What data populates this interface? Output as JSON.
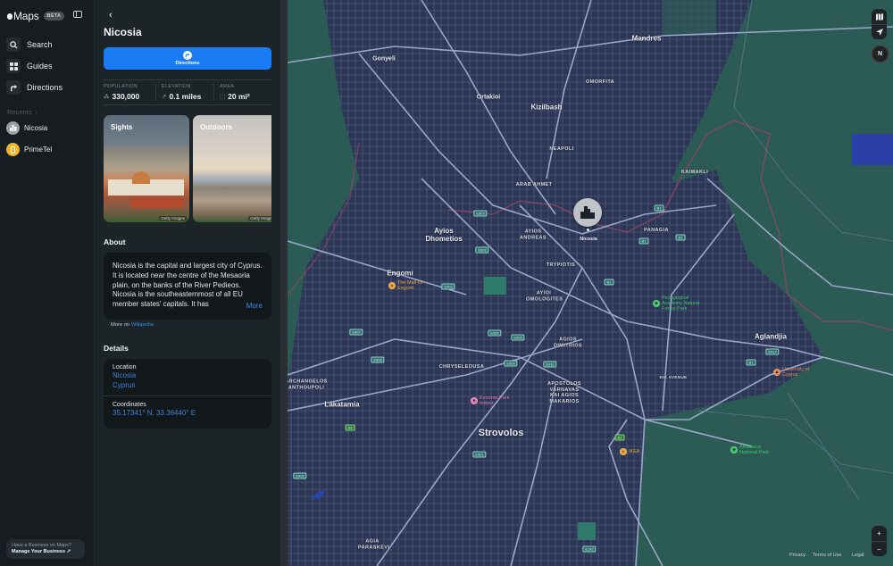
{
  "app": {
    "name": "Maps",
    "badge": "BETA"
  },
  "sidebar": {
    "nav": [
      {
        "label": "Search",
        "icon": "search-icon"
      },
      {
        "label": "Guides",
        "icon": "guides-grid-icon"
      },
      {
        "label": "Directions",
        "icon": "directions-arrow-icon"
      }
    ],
    "recents_label": "Recents",
    "recents": [
      {
        "label": "Nicosia",
        "icon": "city-icon",
        "color": "#9aa0a5"
      },
      {
        "label": "PrimeTel",
        "icon": "phone-store-icon",
        "color": "#f0b429"
      }
    ],
    "business": {
      "line1": "Have a Business on Maps?",
      "line2": "Manage Your Business ↗"
    }
  },
  "place": {
    "title": "Nicosia",
    "directions_label": "Directions",
    "stats": [
      {
        "key": "POPULATION",
        "value": "330,000",
        "icon": "population-icon"
      },
      {
        "key": "ELEVATION",
        "value": "0.1 miles",
        "icon": "elevation-arrow-icon"
      },
      {
        "key": "AREA",
        "value": "20 mi²",
        "icon": "area-square-icon"
      }
    ],
    "guides": [
      {
        "label": "Sights",
        "credit": "Getty Images"
      },
      {
        "label": "Outdoors",
        "credit": "Getty Images"
      }
    ],
    "about_heading": "About",
    "about_text": "Nicosia is the capital and largest city of Cyprus. It is located near the centre of the Mesaoria plain, on the banks of the River Pedieos. Nicosia is the southeasternmost of all EU member states' capitals. It has",
    "about_more": "More",
    "wiki_prefix": "More on",
    "wiki_link": "Wikipedia",
    "details_heading": "Details",
    "details": {
      "location_label": "Location",
      "location_lines": [
        "Nicosia",
        "Cyprus"
      ],
      "coordinates_label": "Coordinates",
      "coordinates": "35.17341° N, 33.36440° E"
    }
  },
  "map": {
    "pin_label": "Nicosia",
    "compass": "N",
    "zoom_in": "+",
    "zoom_out": "−",
    "legal": [
      "Privacy",
      "Terms of Use",
      "Legal"
    ],
    "labels": {
      "mandres": "Mandres",
      "gonyeli": "Gonyeli",
      "ortakioi": "Ortakioi",
      "kizilbash": "Kizilbash",
      "omorfita": "OMORFITA",
      "neapoli": "NEAPOLI",
      "kaimakli": "KAIMAKLI",
      "arab_ahmet": "ARAB AHMET",
      "ayios_dhometios": "Ayios Dhometios",
      "ayios_andreas": "AYIOS ANDREAS",
      "panagia": "PANAGIA",
      "trypiotis": "TRYPIOTIS",
      "engomi": "Engomi",
      "ayioi_omologites": "AYIOI OMOLOGITES",
      "agios_dimitrios": "AGIOS DIMITRIOS",
      "chryseleousa": "CHRYSELEOUSA",
      "archangelos": "ARCHANGELOS ANTHOUPOLI",
      "apostolos": "APOSTOLOS VARNAVAS KAI AGIOS MAKARIOS",
      "lakatamia": "Lakatamia",
      "strovolos": "Strovolos",
      "aglandjia": "Aglandjia",
      "agia_paraskevi": "AGIA PARASKEVI",
      "kaimakli_road": "KAIMAKLI",
      "eik_avenue": "EIK AVENUE"
    },
    "pois": {
      "mall_engomi": "The Mall Of Engomi",
      "extreme_park": "Extreme Park Indoor",
      "ikea": "IKEA",
      "pedagogical": "Pedagogical Academy Natural Forest Park",
      "university": "University of Cyprus",
      "athalassa": "Athalassa National Park"
    },
    "shields": [
      "E903",
      "E902",
      "B1",
      "B1",
      "B1",
      "B1",
      "A1",
      "A9",
      "E901",
      "E902",
      "E903",
      "E905",
      "E906",
      "E907",
      "E908",
      "E909",
      "E910",
      "E917",
      "B1",
      "E142",
      "A1"
    ]
  }
}
